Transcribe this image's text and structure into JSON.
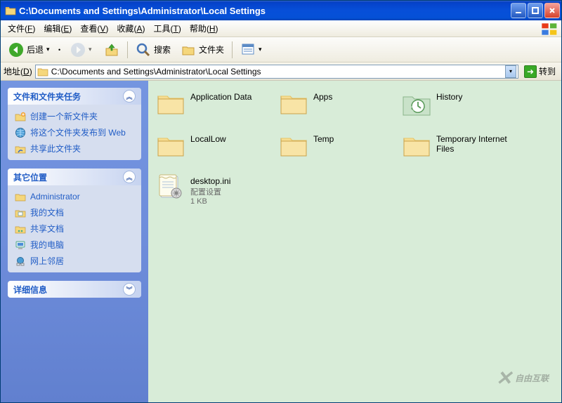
{
  "title": "C:\\Documents and Settings\\Administrator\\Local Settings",
  "menu": {
    "file": "文件",
    "file_acc": "F",
    "edit": "编辑",
    "edit_acc": "E",
    "view": "查看",
    "view_acc": "V",
    "favorites": "收藏",
    "favorites_acc": "A",
    "tools": "工具",
    "tools_acc": "T",
    "help": "帮助",
    "help_acc": "H"
  },
  "toolbar": {
    "back": "后退",
    "search": "搜索",
    "folders": "文件夹"
  },
  "addressbar": {
    "label": "地址",
    "label_acc": "D",
    "path": "C:\\Documents and Settings\\Administrator\\Local Settings",
    "go": "转到"
  },
  "sidebar": {
    "tasks": {
      "title": "文件和文件夹任务",
      "items": [
        {
          "icon": "new-folder",
          "label": "创建一个新文件夹"
        },
        {
          "icon": "publish-web",
          "label": "将这个文件夹发布到 Web"
        },
        {
          "icon": "share-folder",
          "label": "共享此文件夹"
        }
      ]
    },
    "other": {
      "title": "其它位置",
      "items": [
        {
          "icon": "folder",
          "label": "Administrator"
        },
        {
          "icon": "mydocs",
          "label": "我的文档"
        },
        {
          "icon": "shared-docs",
          "label": "共享文档"
        },
        {
          "icon": "mycomputer",
          "label": "我的电脑"
        },
        {
          "icon": "network",
          "label": "网上邻居"
        }
      ]
    },
    "details": {
      "title": "详细信息"
    }
  },
  "content": {
    "items": [
      {
        "type": "folder",
        "name": "Application Data"
      },
      {
        "type": "folder",
        "name": "Apps"
      },
      {
        "type": "history-folder",
        "name": "History"
      },
      {
        "type": "folder",
        "name": "LocalLow"
      },
      {
        "type": "folder",
        "name": "Temp"
      },
      {
        "type": "folder",
        "name": "Temporary Internet Files"
      },
      {
        "type": "ini-file",
        "name": "desktop.ini",
        "desc": "配置设置",
        "size": "1 KB"
      }
    ]
  },
  "watermark": "自由互联"
}
